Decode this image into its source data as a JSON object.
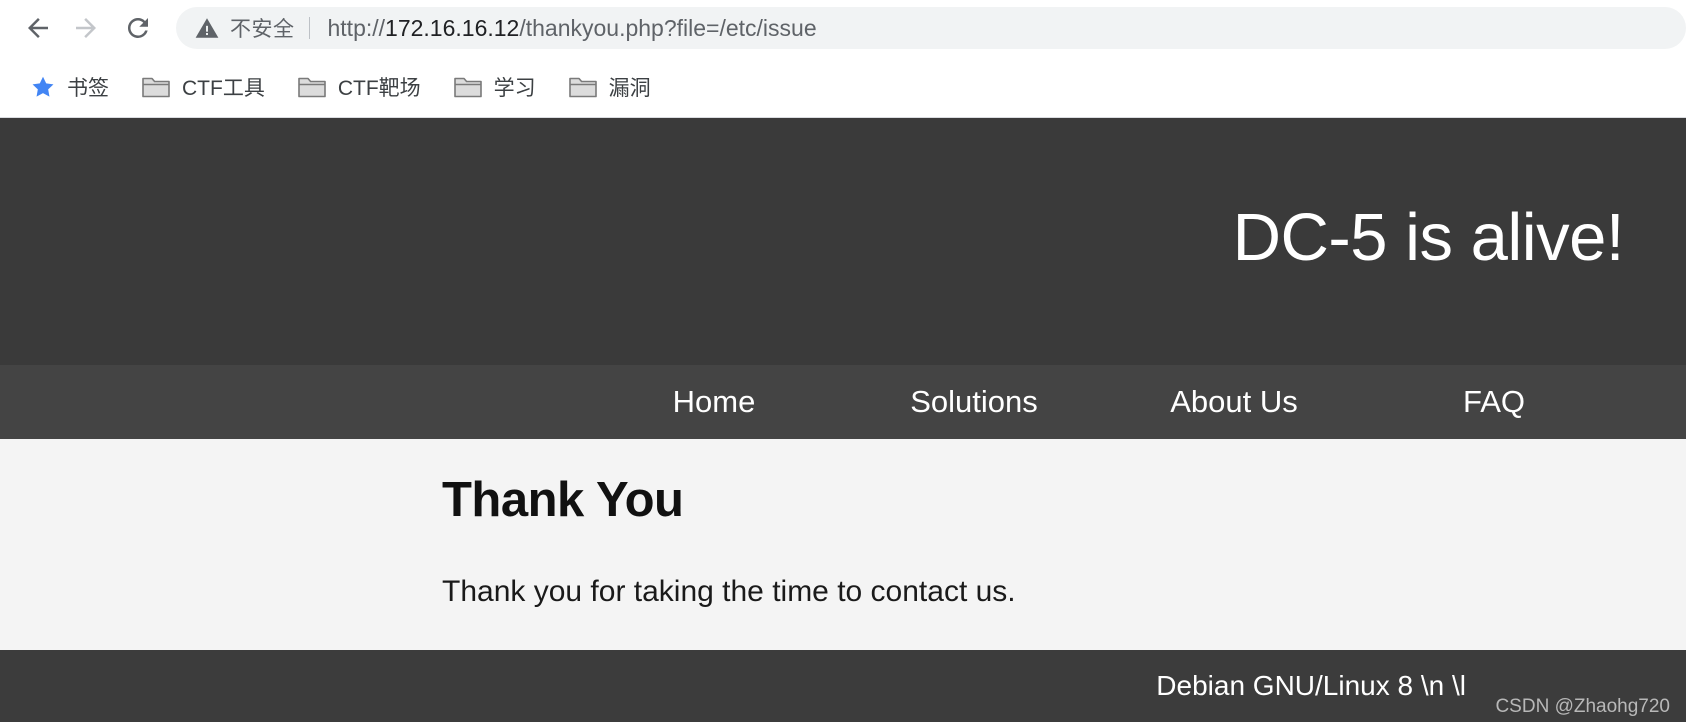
{
  "browser": {
    "back_label": "Back",
    "forward_label": "Forward",
    "reload_label": "Reload",
    "security_status": "不安全",
    "url_full": "http://172.16.16.12/thankyou.php?file=/etc/issue",
    "url_scheme": "http://",
    "url_host": "172.16.16.12",
    "url_path": "/thankyou.php?file=/etc/issue",
    "bookmarks": [
      {
        "label": "书签",
        "icon": "star-icon"
      },
      {
        "label": "CTF工具",
        "icon": "folder-icon"
      },
      {
        "label": "CTF靶场",
        "icon": "folder-icon"
      },
      {
        "label": "学习",
        "icon": "folder-icon"
      },
      {
        "label": "漏洞",
        "icon": "folder-icon"
      }
    ]
  },
  "site": {
    "banner_title": "DC-5 is alive!",
    "nav": [
      {
        "label": "Home"
      },
      {
        "label": "Solutions"
      },
      {
        "label": "About Us"
      },
      {
        "label": "FAQ"
      }
    ],
    "main": {
      "heading": "Thank You",
      "paragraph": "Thank you for taking the time to contact us."
    },
    "footer": {
      "text": "Debian GNU/Linux 8 \\n \\l"
    }
  },
  "watermark": "CSDN @Zhaohg720",
  "colors": {
    "header_bg": "#3a3a3a",
    "nav_bg": "#444444",
    "content_bg": "#f4f4f4",
    "footer_bg": "#3c3c3c",
    "star_blue": "#4285f4",
    "chrome_text": "#5f6368"
  }
}
